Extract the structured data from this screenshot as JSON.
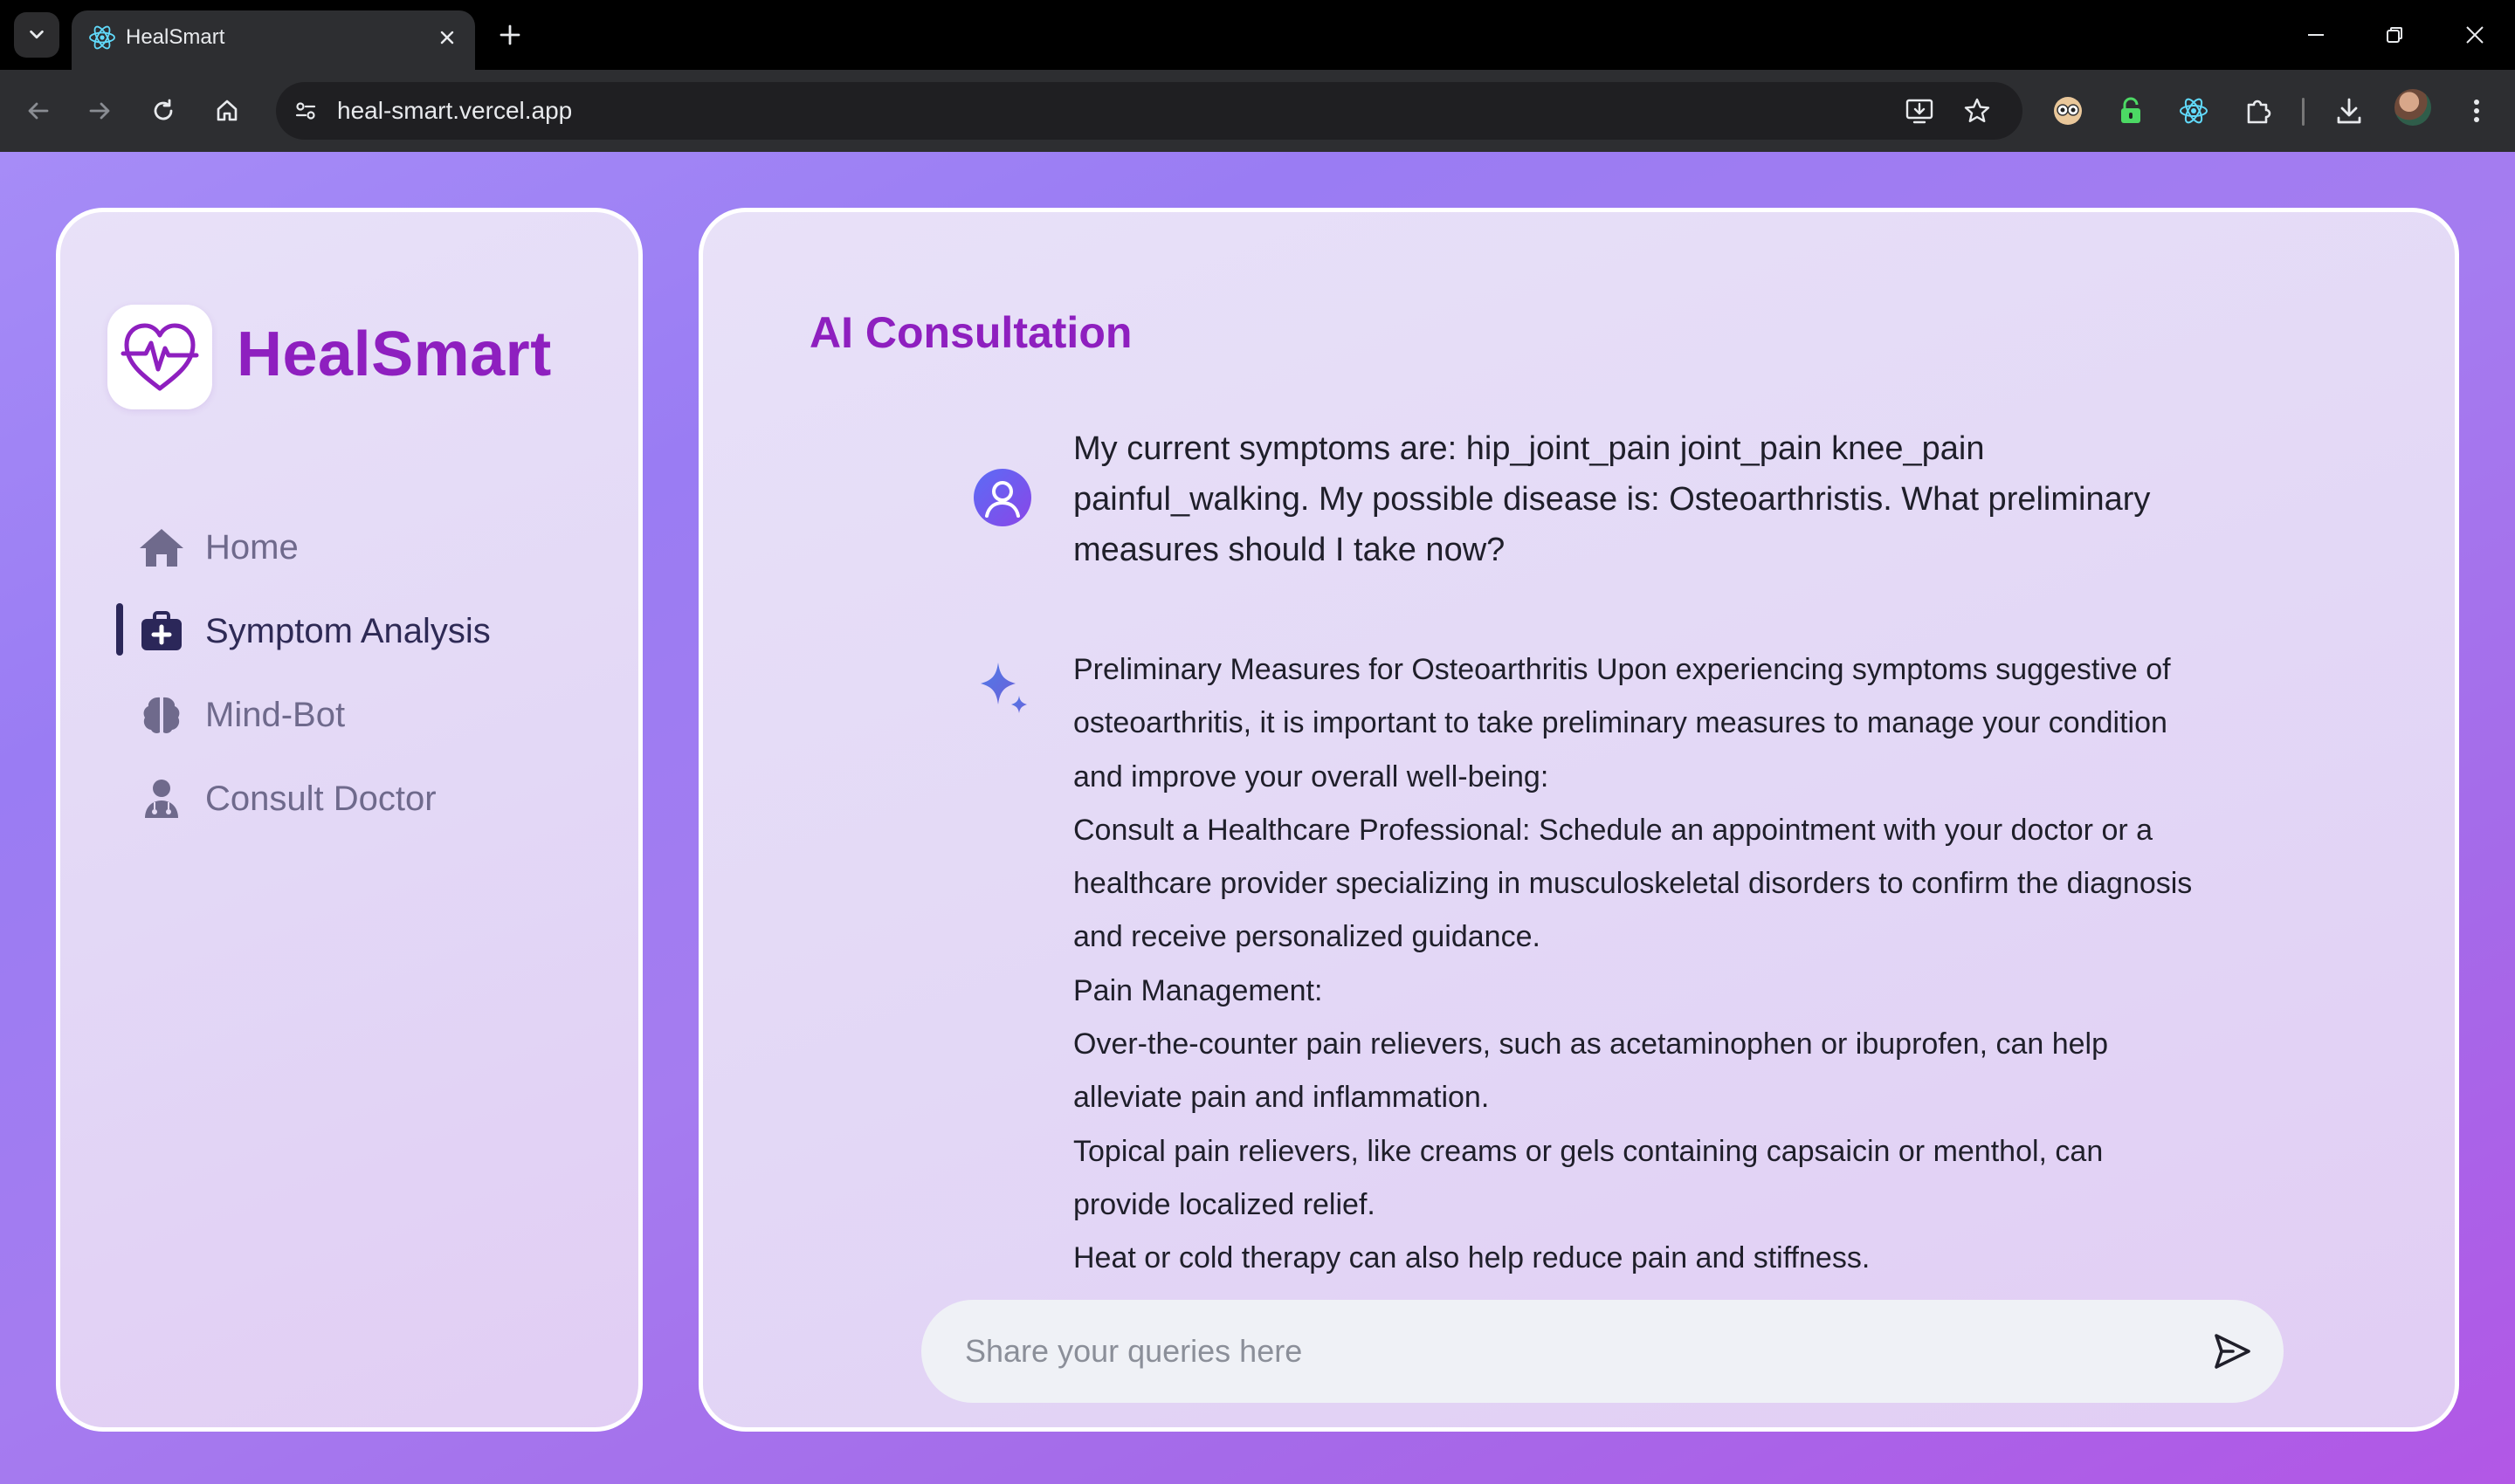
{
  "browser": {
    "tab_title": "HealSmart",
    "url": "heal-smart.vercel.app"
  },
  "sidebar": {
    "brand": "HealSmart",
    "items": [
      {
        "label": "Home",
        "icon": "home-icon",
        "active": false
      },
      {
        "label": "Symptom Analysis",
        "icon": "medical-kit-icon",
        "active": true
      },
      {
        "label": "Mind-Bot",
        "icon": "brain-icon",
        "active": false
      },
      {
        "label": "Consult Doctor",
        "icon": "doctor-icon",
        "active": false
      }
    ]
  },
  "main": {
    "title": "AI Consultation",
    "user_message": "My current symptoms are: hip_joint_pain joint_pain knee_pain painful_walking. My possible disease is: Osteoarthristis. What preliminary measures should I take now?",
    "ai_response": [
      "Preliminary Measures for Osteoarthritis Upon experiencing symptoms suggestive of osteoarthritis, it is important to take preliminary measures to manage your condition and improve your overall well-being:",
      "Consult a Healthcare Professional: Schedule an appointment with your doctor or a healthcare provider specializing in musculoskeletal disorders to confirm the diagnosis and receive personalized guidance.",
      "Pain Management:",
      "Over-the-counter pain relievers, such as acetaminophen or ibuprofen, can help alleviate pain and inflammation.",
      "Topical pain relievers, like creams or gels containing capsaicin or menthol, can provide localized relief.",
      "Heat or cold therapy can also help reduce pain and stiffness."
    ],
    "query_placeholder": "Share your queries here"
  },
  "colors": {
    "brand": "#8e1fbf",
    "nav_active": "#2e2a55",
    "nav_inactive": "#6f6a8c"
  }
}
